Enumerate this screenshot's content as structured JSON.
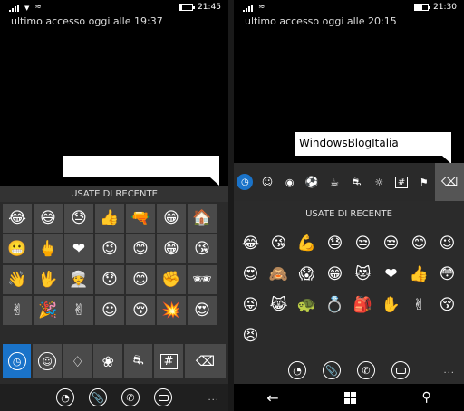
{
  "left": {
    "status": {
      "time": "21:45"
    },
    "last_seen": "ultimo accesso oggi alle 19:37",
    "bubble_text": "",
    "recent_header": "USATE DI RECENTE",
    "emoji_rows": [
      [
        "😂",
        "😅",
        "😓",
        "👍",
        "🔫",
        "😁",
        "🏠"
      ],
      [
        "😬",
        "🖕",
        "❤",
        "😉",
        "😊",
        "😁",
        "😘"
      ],
      [
        "👋",
        "🖖",
        "👳",
        "😯",
        "😊",
        "✊",
        "🕶"
      ],
      [
        "✌",
        "🎉",
        "✌",
        "☺",
        "😚",
        "💥",
        "😍"
      ]
    ],
    "tab_icons": [
      "clock-icon",
      "smiley-icon",
      "bell-icon",
      "flower-icon",
      "car-icon",
      "hash-icon",
      "backspace-icon"
    ],
    "bottom_icons": [
      "sticker-icon",
      "attach-icon",
      "phone-icon",
      "keyboard-icon"
    ],
    "more": "..."
  },
  "right": {
    "status": {
      "time": "21:30"
    },
    "last_seen": "ultimo accesso oggi alle 20:15",
    "bubble_text": "WindowsBlogItalia",
    "recent_header": "USATE DI RECENTE",
    "category_tabs": [
      "clock-icon",
      "smiley-icon",
      "cat-icon",
      "ball-icon",
      "cup-icon",
      "car-icon",
      "bulb-icon",
      "hash-icon",
      "flag-icon",
      "backspace-icon"
    ],
    "emoji_rows": [
      [
        "😂",
        "😘",
        "💪",
        "😓",
        "😒",
        "😒",
        "😊"
      ],
      [
        "😉",
        "😍",
        "🙈",
        "😱",
        "😁",
        "😻",
        "❤"
      ],
      [
        "👍",
        "😳",
        "😜",
        "😹",
        "🐢",
        "💍",
        "🎒"
      ],
      [
        "✋",
        "✌",
        "😚",
        "😣"
      ]
    ],
    "bottom_icons": [
      "sticker-icon",
      "attach-icon",
      "phone-icon",
      "keyboard-icon"
    ],
    "nav_icons": [
      "back-icon",
      "windows-icon",
      "search-icon"
    ],
    "more": "..."
  },
  "colors": {
    "accent": "#1a73c9",
    "key": "#4a4a4a",
    "keyboard_bg": "#2b2b2b"
  }
}
